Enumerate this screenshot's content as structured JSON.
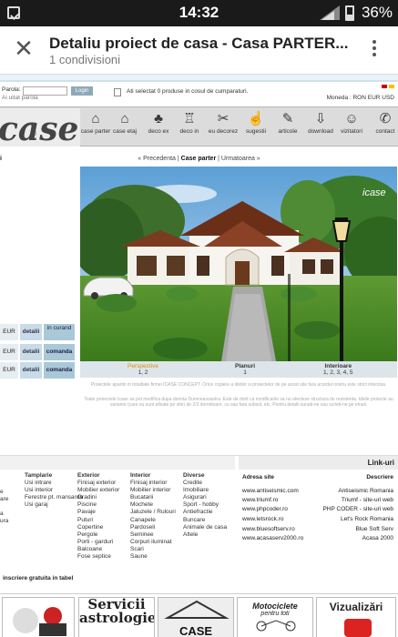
{
  "status": {
    "time": "14:32",
    "battery": "36%"
  },
  "appbar": {
    "title": "Detaliu proiect de casa - Casa PARTER...",
    "subtitle": "1 condivisioni"
  },
  "login": {
    "password_label": "Parola:",
    "forgot": "Ai uitat parola",
    "login_button": "Login",
    "cart_text": "Ati selectat 0 produse in cosul de cumparaturi.",
    "currency": "Moneda : RON EUR USD"
  },
  "nav": {
    "logo": "case",
    "items": [
      {
        "label": "case parter"
      },
      {
        "label": "case etaj"
      },
      {
        "label": "deco ex"
      },
      {
        "label": "deco in"
      },
      {
        "label": "eu decorez"
      },
      {
        "label": "sugestii"
      },
      {
        "label": "articole"
      },
      {
        "label": "download"
      },
      {
        "label": "vizitatori"
      },
      {
        "label": "contact"
      }
    ]
  },
  "breadcrumb": {
    "prev": "« Precedenta",
    "current": "Case parter",
    "next": "Urmatoarea »"
  },
  "photo_watermark": "icase",
  "tabs": {
    "perspective": {
      "title": "Perspective",
      "nums": "1, 2"
    },
    "planuri": {
      "title": "Planuri",
      "nums": "1"
    },
    "interioare": {
      "title": "Interioare",
      "nums": "1, 2, 3, 4, 5"
    }
  },
  "notes": {
    "n1": "Proiectele apartin in totalitate firmei ICASE CONCEPT. Orice copiere a ideilor si proiectelor de pe acest site fara acordul nostru este strict interzisa.",
    "n2": "Toate proiectele Icase se pot modifica dupa dorinta Dumneavoastra. Este de dorit ca modificarile sa nu afecteze structura de rezistenta. Ideile proiecte au variante (care nu sunt afisate pe site) de 2/3 dormitoare, cu sau fara subsol, etc. Pentru detalii sunati-ne sau scrieti-ne pe email."
  },
  "price_rows": [
    {
      "currency": "EUR",
      "detail": "detalii",
      "status": "in curand"
    },
    {
      "currency": "EUR",
      "detail": "detalii",
      "status": "comanda"
    },
    {
      "currency": "EUR",
      "detail": "detalii",
      "status": "comanda"
    }
  ],
  "footer": {
    "links_header": "Link-uri",
    "tamplarie": {
      "h": "Tamplarie",
      "items": [
        "Usi intrare",
        "Usi interior",
        "Ferestre pt. mansarda",
        "Usi garaj"
      ]
    },
    "exterior": {
      "h": "Exterior",
      "items": [
        "Finisaj exterior",
        "Mobilier exterior",
        "Gradini",
        "Piscine",
        "Pavaje",
        "Puturi",
        "Copertine",
        "Pergole",
        "Porti - garduri",
        "Balcoane",
        "Fose septice"
      ]
    },
    "interior": {
      "h": "Interior",
      "items": [
        "Finisaj interior",
        "Mobilier interior",
        "Bucatarii",
        "Mochete",
        "Jaluzele / Rulouri",
        "Canapele",
        "Pardoseli",
        "Seminee",
        "Corpuri iluminat",
        "Scari",
        "Saune"
      ]
    },
    "diverse": {
      "h": "Diverse",
      "items": [
        "Credite",
        "Imobiliare",
        "Asigurari",
        "Sport - hobby",
        "Antiefractie",
        "Buncare",
        "Animale de casa",
        "Altele"
      ]
    },
    "left_partial": [
      "e",
      "are",
      "a",
      "ura"
    ],
    "adresa_h": "Adresa site",
    "descriere_h": "Descriere",
    "sites": [
      {
        "url": "www.antiseismic.com",
        "desc": "Antiseismic Romania"
      },
      {
        "url": "www.triumf.ro",
        "desc": "Triumf - site-uri web"
      },
      {
        "url": "www.phpcoder.ro",
        "desc": "PHP CODER - site-uri web"
      },
      {
        "url": "www.letsrock.ro",
        "desc": "Let's Rock Romania"
      },
      {
        "url": "www.bluesoftserv.ro",
        "desc": "Blue Soft Serv"
      },
      {
        "url": "www.acasaserv2000.ro",
        "desc": "Acasa 2000"
      }
    ],
    "inscriere": "inscriere gratuita in tabel"
  },
  "ads": [
    {
      "line1": "Servicii",
      "line2": "astrologie"
    },
    {
      "line1": "CASE PASIVE"
    },
    {
      "line1": "Motociclete",
      "line2": "pentru toti"
    },
    {
      "line1": "Vizualizări"
    }
  ]
}
